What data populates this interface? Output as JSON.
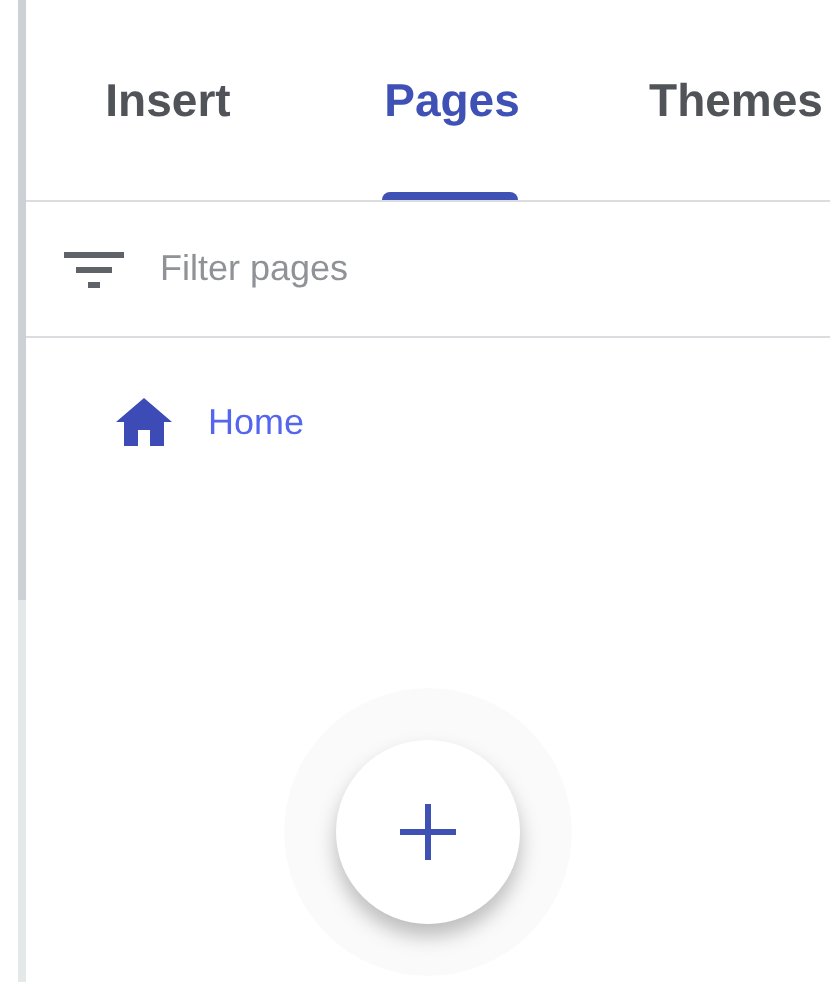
{
  "tabs": [
    {
      "label": "Insert",
      "selected": false
    },
    {
      "label": "Pages",
      "selected": true
    },
    {
      "label": "Themes",
      "selected": false
    }
  ],
  "filter": {
    "placeholder": "Filter pages"
  },
  "pages": [
    {
      "label": "Home",
      "kind": "home"
    }
  ]
}
